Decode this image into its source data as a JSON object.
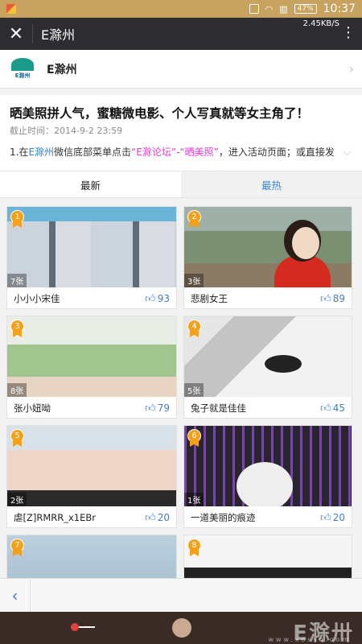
{
  "statusbar": {
    "battery": "47%",
    "time": "10:37"
  },
  "titlebar": {
    "close_icon": "close-icon",
    "title": "E滁州",
    "speed": "2.45KB/S",
    "menu_icon": "more-vertical-icon"
  },
  "account": {
    "name": "E滁州",
    "logo_text": "E滁州"
  },
  "article": {
    "title": "晒美照拼人气，蜜糖微电影、个人写真就等女主角了！",
    "meta": "截止时间：2014-9-2 23:59",
    "intro_parts": [
      "1.在",
      "E滁州",
      "微信底部菜单点击",
      "“E滁论坛”-“晒美照”",
      "，进入活动页面；或直接发"
    ]
  },
  "tabs": [
    {
      "label": "最新"
    },
    {
      "label": "最热"
    }
  ],
  "cards": [
    {
      "rank": "1",
      "count": "7张",
      "name": "小小小宋佳",
      "likes": "93"
    },
    {
      "rank": "2",
      "count": "3张",
      "name": "悲剧女王",
      "likes": "89"
    },
    {
      "rank": "3",
      "count": "8张",
      "name": "张小妞呦",
      "likes": "79"
    },
    {
      "rank": "4",
      "count": "5张",
      "name": "兔子就是佳佳",
      "likes": "45"
    },
    {
      "rank": "5",
      "count": "2张",
      "name": "虐[Z]RMRR_x1EBr",
      "likes": "20"
    },
    {
      "rank": "6",
      "count": "1张",
      "name": "一道美丽的痕迹",
      "likes": "20"
    },
    {
      "rank": "7",
      "count": "",
      "name": "",
      "likes": ""
    },
    {
      "rank": "8",
      "count": "",
      "name": "",
      "likes": ""
    }
  ],
  "navbar": {
    "back_icon": "chevron-left-icon"
  },
  "watermark": {
    "main": "E滁卅",
    "sub": "www.xosso.com"
  }
}
